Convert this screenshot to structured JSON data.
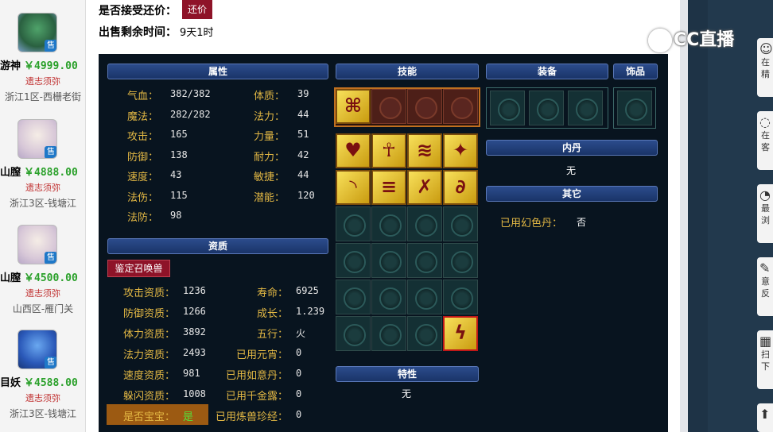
{
  "listing": [
    {
      "name": "游神",
      "price": "￥4999.00",
      "warn": "遗志须弥",
      "location": "浙江1区-西栅老街",
      "tag": "售"
    },
    {
      "name": "山膣",
      "price": "￥4888.00",
      "warn": "遗志须弥",
      "location": "浙江3区-钱塘江",
      "tag": "售"
    },
    {
      "name": "山膣",
      "price": "￥4500.00",
      "warn": "遗志须弥",
      "location": "山西区-雁门关",
      "tag": "售"
    },
    {
      "name": "目妖",
      "price": "￥4588.00",
      "warn": "遗志须弥",
      "location": "浙江3区-钱塘江",
      "tag": "售"
    }
  ],
  "header": {
    "accept_bargain_label": "是否接受还价：",
    "bargain_button": "还价",
    "remaining_label": "出售剩余时间：",
    "remaining_value": "9天1时"
  },
  "watermark": "CC直播",
  "sections": {
    "attributes": "属性",
    "skills": "技能",
    "equipment": "装备",
    "accessory": "饰品",
    "inner_dan": "内丹",
    "inner_dan_value": "无",
    "other": "其它",
    "aptitude": "资质",
    "traits": "特性",
    "traits_value": "无"
  },
  "attributes": {
    "left": [
      {
        "label": "气血：",
        "value": "382/382"
      },
      {
        "label": "魔法：",
        "value": "282/282"
      },
      {
        "label": "攻击：",
        "value": "165"
      },
      {
        "label": "防御：",
        "value": "138"
      },
      {
        "label": "速度：",
        "value": "43"
      },
      {
        "label": "法伤：",
        "value": "115"
      },
      {
        "label": "法防：",
        "value": "98"
      }
    ],
    "right": [
      {
        "label": "体质：",
        "value": "39"
      },
      {
        "label": "法力：",
        "value": "44"
      },
      {
        "label": "力量：",
        "value": "51"
      },
      {
        "label": "耐力：",
        "value": "42"
      },
      {
        "label": "敏捷：",
        "value": "44"
      },
      {
        "label": "潜能：",
        "value": "120"
      }
    ]
  },
  "appraise_button": "鉴定召唤兽",
  "aptitude": {
    "left": [
      {
        "label": "攻击资质：",
        "value": "1236"
      },
      {
        "label": "防御资质：",
        "value": "1266"
      },
      {
        "label": "体力资质：",
        "value": "3892"
      },
      {
        "label": "法力资质：",
        "value": "2493"
      },
      {
        "label": "速度资质：",
        "value": "981"
      },
      {
        "label": "躲闪资质：",
        "value": "1008"
      }
    ],
    "right": [
      {
        "label": "寿命：",
        "value": "6925"
      },
      {
        "label": "成长：",
        "value": "1.239"
      },
      {
        "label": "五行：",
        "value": "火"
      },
      {
        "label": "已用元宵：",
        "value": "0"
      },
      {
        "label": "已用如意丹：",
        "value": "0"
      },
      {
        "label": "已用千金露：",
        "value": "0"
      },
      {
        "label": "已用炼兽珍经：",
        "value": "0"
      }
    ],
    "baobao_label": "是否宝宝：",
    "baobao_value": "是"
  },
  "other": {
    "label": "已用幻色丹：",
    "value": "否"
  },
  "skills": {
    "top_row": [
      "skill-icon",
      "locked",
      "locked",
      "locked"
    ],
    "grid_active": [
      "heart-skill-icon",
      "figure-skill-icon",
      "rush-skill-icon",
      "fire-skill-icon",
      "wave-skill-icon",
      "speed-skill-icon",
      "claw-skill-icon",
      "hook-skill-icon"
    ],
    "grid_special": "lightning-skill-icon"
  },
  "colors": {
    "accent": "#8e1328",
    "label": "#e3b844",
    "price": "#2aa02a",
    "panel": "#08141f"
  }
}
